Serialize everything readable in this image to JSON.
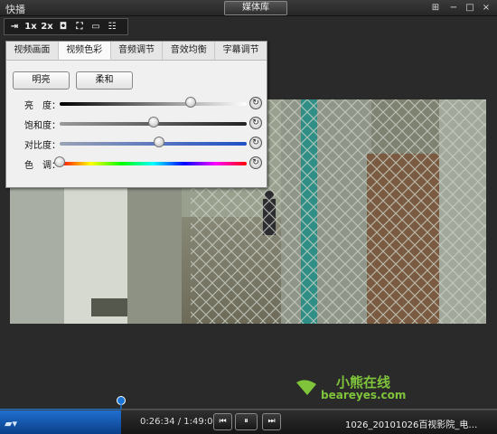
{
  "app": {
    "title": "快播",
    "media_library_label": "媒体库"
  },
  "window_controls": {
    "menu": "⊞",
    "minimize": "−",
    "maximize": "□",
    "close": "×"
  },
  "toolbar": {
    "items": [
      {
        "name": "pin-icon",
        "glyph": "⇥"
      },
      {
        "name": "speed-1x",
        "label": "1x"
      },
      {
        "name": "speed-2x",
        "label": "2x"
      },
      {
        "name": "screenshot-icon",
        "glyph": "◘"
      },
      {
        "name": "fit-screen-icon",
        "glyph": "⛶"
      },
      {
        "name": "fullscreen-icon",
        "glyph": "▭"
      },
      {
        "name": "settings-icon",
        "glyph": "☷"
      }
    ]
  },
  "panel": {
    "tabs": [
      "视频画面",
      "视频色彩",
      "音频调节",
      "音效均衡",
      "字幕调节"
    ],
    "active_tab": 1,
    "presets": {
      "bright": "明亮",
      "soft": "柔和"
    },
    "sliders": [
      {
        "label": "亮　度：",
        "value": 0.7
      },
      {
        "label": "饱和度：",
        "value": 0.5
      },
      {
        "label": "对比度：",
        "value": 0.53
      },
      {
        "label": "色　调：",
        "value": 0.0
      }
    ]
  },
  "watermark": {
    "cn": "小熊在线",
    "en": "beareyes.com"
  },
  "playback": {
    "current": "0:26:34",
    "total": "1:49:01",
    "time_display": "0:26:34 / 1:49:01",
    "progress": 0.244,
    "file_title": "1026_20101026百视影院_电…"
  },
  "colors": {
    "accent": "#1a74d6",
    "watermark": "#7fc43a"
  }
}
